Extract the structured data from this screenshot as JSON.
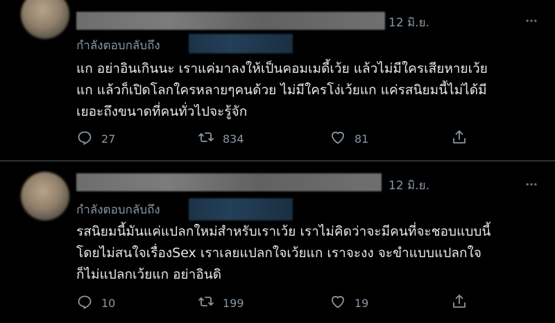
{
  "tweets": [
    {
      "date": "12 มิ.ย.",
      "reply_label": "กำลังตอบกลับถึง",
      "text": "แก อย่าอินเกินนะ เราแค่มาลงให้เป็นคอมเมดี้เว้ย แล้วไม่มีใครเสียหายเว้ย\nแก แล้วก็เปิดโลกใครหลายๆคนด้วย ไม่มีใครโง่เว้ยแก แค่รสนิยมนี้ไม่ได้มี\nเยอะถึงขนาดที่คนทั่วไปจะรู้จัก",
      "reply_count": "27",
      "retweet_count": "834",
      "like_count": "81"
    },
    {
      "date": "12 มิ.ย.",
      "reply_label": "กำลังตอบกลับถึง",
      "text": "รสนิยมนี้มันแค่แปลกใหม่สำหรับเราเว้ย เราไม่คิดว่าจะมีคนที่จะชอบแบบนี้\nโดยไม่สนใจเรื่องSex เราเลยแปลกใจเว้ยแก เราจะงง จะขำแบบแปลกใจ\nก็ไม่แปลกเว้ยแก อย่าอินดิ",
      "reply_count": "10",
      "retweet_count": "199",
      "like_count": "19"
    }
  ],
  "icons": {
    "reply": "reply-icon",
    "retweet": "retweet-icon",
    "like": "heart-icon",
    "share": "share-icon",
    "more": "more-icon"
  },
  "colors": {
    "background": "#000000",
    "text": "#e7e9ea",
    "muted": "#8b98a5",
    "divider": "#2f3336"
  }
}
